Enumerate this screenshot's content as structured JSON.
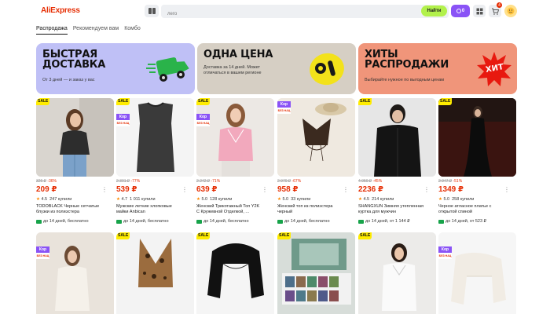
{
  "header": {
    "logo": "AliExpress",
    "search_placeholder": "лего",
    "search_button": "Найти",
    "coins_count": "0",
    "cart_count": "4",
    "icons": [
      "catalog-icon",
      "coin-icon",
      "orders-icon",
      "cart-icon",
      "avatar-icon"
    ]
  },
  "tabs": [
    {
      "label": "Распродажа"
    },
    {
      "label": "Рекомендуем вам"
    },
    {
      "label": "Комбо"
    }
  ],
  "banners": [
    {
      "title_line1": "БЫСТРАЯ",
      "title_line2": "ДОСТАВКА",
      "subtitle": "От 3 дней — и заказ у вас",
      "color": "#bfc0f6"
    },
    {
      "title_line1": "ОДНА ЦЕНА",
      "subtitle_line1": "Доставка за 14 дней. Может",
      "subtitle_line2": "отличаться в вашем регионе",
      "color": "#d6cfc4"
    },
    {
      "title_line1": "ХИТЫ",
      "title_line2": "РАСПРОДАЖИ",
      "subtitle": "Выбирайте нужное по выгодным ценам",
      "badge": "ХИТ",
      "color": "#f0957a"
    }
  ],
  "sale_tag": "SALE",
  "koi_tag": "Кор",
  "koi_sub": "БЕЗ НАЦ",
  "products": [
    {
      "old_price": "326 ₽",
      "discount": "-36%",
      "price": "209 ₽",
      "rating": "4.5",
      "bought": "247 купили",
      "title_line1": "TODOBLACK Черные сетчатые",
      "title_line2": "блузки из полиэстера",
      "delivery": "до 14 дней, бесплатно",
      "sale": true,
      "koi": false
    },
    {
      "old_price": "2 301 ₽",
      "discount": "-77%",
      "price": "539 ₽",
      "rating": "4.7",
      "bought": "1 011 купили",
      "title_line1": "Мужские летние хлопковые",
      "title_line2": "майки Anbican",
      "delivery": "до 14 дней, бесплатно",
      "sale": true,
      "koi": true
    },
    {
      "old_price": "2 242 ₽",
      "discount": "-71%",
      "price": "639 ₽",
      "rating": "5.0",
      "bought": "128 купили",
      "title_line1": "Женский Трикотажный Топ Y2K",
      "title_line2": "С Кружевной Отделкой, ...",
      "delivery": "до 14 дней, бесплатно",
      "sale": true,
      "koi": true
    },
    {
      "old_price": "2 970 ₽",
      "discount": "-67%",
      "price": "958 ₽",
      "rating": "5.0",
      "bought": "33 купили",
      "title_line1": "Женский топ из полиэстера",
      "title_line2": "черный",
      "delivery": "до 14 дней, бесплатно",
      "sale": false,
      "koi": true
    },
    {
      "old_price": "4 050 ₽",
      "discount": "-45%",
      "price": "2236 ₽",
      "rating": "4.5",
      "bought": "214 купили",
      "title_line1": "SHANGXUN Зимняя утепленная",
      "title_line2": "куртка для мужчин",
      "delivery": "до 14 дней, от 1 144 ₽",
      "sale": true,
      "koi": false
    },
    {
      "old_price": "2 947 ₽",
      "discount": "-51%",
      "price": "1349 ₽",
      "rating": "5.0",
      "bought": "258 купили",
      "title_line1": "Черное атласное платье с",
      "title_line2": "открытой спиной",
      "delivery": "до 14 дней, от 523 ₽",
      "sale": true,
      "koi": false
    }
  ],
  "products_row2": [
    {
      "sale": false,
      "koi": true
    },
    {
      "sale": true,
      "koi": false
    },
    {
      "sale": true,
      "koi": false
    },
    {
      "sale": true,
      "koi": false
    },
    {
      "sale": true,
      "koi": false
    },
    {
      "sale": false,
      "koi": true
    }
  ],
  "colors": {
    "accent": "#e62e04",
    "search_button": "#b2f14b",
    "coins": "#8a53f6",
    "sale_yellow": "#ffec00",
    "delivery_green": "#17a34a"
  }
}
